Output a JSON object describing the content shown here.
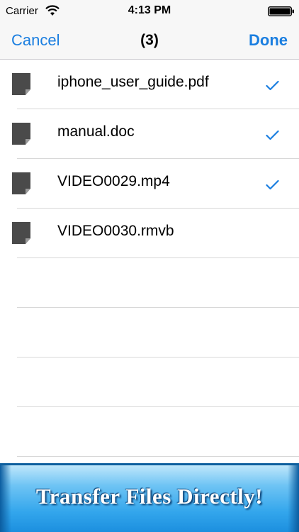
{
  "status_bar": {
    "carrier": "Carrier",
    "wifi_icon": "wifi-icon",
    "time": "4:13 PM",
    "battery_icon": "battery-icon"
  },
  "nav": {
    "cancel_label": "Cancel",
    "title": "(3)",
    "done_label": "Done",
    "accent_color": "#1a7ee0"
  },
  "files": [
    {
      "name": "iphone_user_guide.pdf",
      "icon": "document-icon",
      "selected": true
    },
    {
      "name": "manual.doc",
      "icon": "document-icon",
      "selected": true
    },
    {
      "name": "VIDEO0029.mp4",
      "icon": "document-icon",
      "selected": true
    },
    {
      "name": "VIDEO0030.rmvb",
      "icon": "document-icon",
      "selected": false
    }
  ],
  "banner": {
    "text": "Transfer Files Directly!",
    "color": "#33a6ec"
  }
}
